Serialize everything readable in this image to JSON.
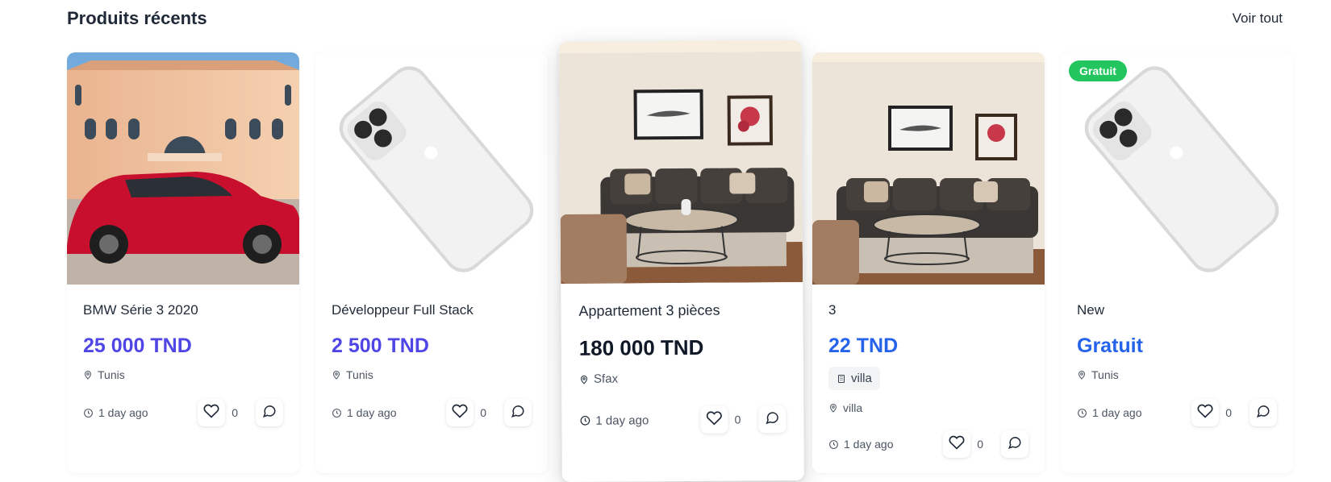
{
  "section": {
    "title": "Produits récents",
    "see_all": "Voir tout"
  },
  "cards": [
    {
      "title": "BMW Série 3 2020",
      "price": "25 000 TND",
      "location": "Tunis",
      "time": "1 day ago",
      "likes": "0",
      "image": "red-car-villa"
    },
    {
      "title": "Développeur Full Stack",
      "price": "2 500 TND",
      "location": "Tunis",
      "time": "1 day ago",
      "likes": "0",
      "image": "white-phone"
    },
    {
      "title": "Appartement 3 pièces",
      "price": "180 000 TND",
      "location": "Sfax",
      "time": "1 day ago",
      "likes": "0",
      "image": "living-room"
    },
    {
      "title": "3",
      "price": "22 TND",
      "category": "villa",
      "location": "villa",
      "time": "1 day ago",
      "likes": "0",
      "image": "living-room"
    },
    {
      "title": "New",
      "price": "Gratuit",
      "badge": "Gratuit",
      "location": "Tunis",
      "time": "1 day ago",
      "likes": "0",
      "image": "white-phone"
    }
  ],
  "colors": {
    "price": "#4f46e5",
    "price_free": "#2563eb",
    "badge": "#22c55e"
  },
  "icons": [
    "map-pin-icon",
    "clock-icon",
    "heart-icon",
    "chat-icon",
    "building-icon"
  ]
}
